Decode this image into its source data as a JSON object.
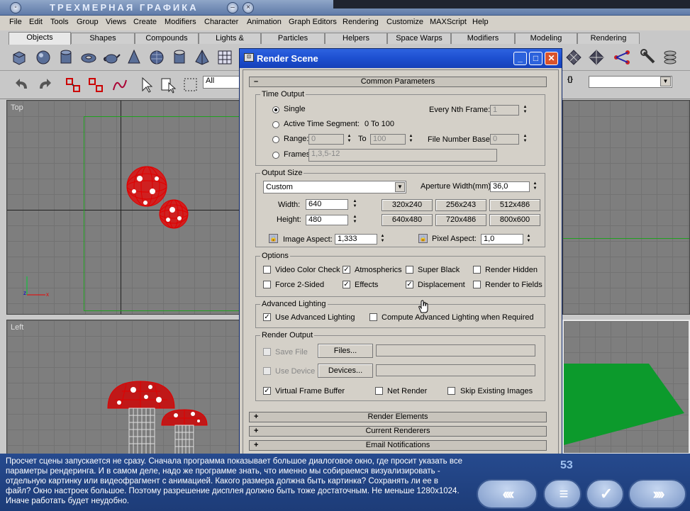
{
  "course_title": "ТРЕХМЕРНАЯ ГРАФИКА",
  "menu": [
    "File",
    "Edit",
    "Tools",
    "Group",
    "Views",
    "Create",
    "Modifiers",
    "Character",
    "Animation",
    "Graph Editors",
    "Rendering",
    "Customize",
    "MAXScript",
    "Help"
  ],
  "tabs": [
    "Objects",
    "Shapes",
    "Compounds",
    "Lights & Cameras",
    "Particles",
    "Helpers",
    "Space Warps",
    "Modifiers",
    "Modeling",
    "Rendering"
  ],
  "toolbar": {
    "selection_filter": "All"
  },
  "viewports": {
    "top_label": "Top",
    "left_label": "Left"
  },
  "dialog": {
    "title": "Render Scene",
    "common_params": "Common Parameters",
    "time_output": {
      "title": "Time Output",
      "single": "Single",
      "every_nth_frame": "Every Nth Frame:",
      "every_nth_value": "1",
      "active_time_segment": "Active Time Segment:",
      "active_time_value": "0 To 100",
      "range": "Range:",
      "range_from": "0",
      "range_to_label": "To",
      "range_to": "100",
      "file_number_base": "File Number Base:",
      "file_number_value": "0",
      "frames": "Frames",
      "frames_value": "1,3,5-12"
    },
    "output_size": {
      "title": "Output Size",
      "preset": "Custom",
      "aperture_label": "Aperture Width(mm):",
      "aperture_value": "36,0",
      "width_label": "Width:",
      "width_value": "640",
      "height_label": "Height:",
      "height_value": "480",
      "presets": [
        "320x240",
        "256x243",
        "512x486",
        "640x480",
        "720x486",
        "800x600"
      ],
      "image_aspect_label": "Image Aspect:",
      "image_aspect_value": "1,333",
      "pixel_aspect_label": "Pixel Aspect:",
      "pixel_aspect_value": "1,0"
    },
    "options": {
      "title": "Options",
      "video_color_check": "Video Color Check",
      "atmospherics": "Atmospherics",
      "super_black": "Super Black",
      "render_hidden": "Render Hidden",
      "force_2_sided": "Force 2-Sided",
      "effects": "Effects",
      "displacement": "Displacement",
      "render_to_fields": "Render to Fields"
    },
    "advanced_lighting": {
      "title": "Advanced Lighting",
      "use": "Use Advanced Lighting",
      "compute": "Compute Advanced Lighting when Required"
    },
    "render_output": {
      "title": "Render Output",
      "save_file": "Save File",
      "files_btn": "Files...",
      "use_device": "Use Device",
      "devices_btn": "Devices...",
      "virtual_frame_buffer": "Virtual Frame Buffer",
      "net_render": "Net Render",
      "skip_existing": "Skip Existing Images"
    },
    "rollups": [
      "Render Elements",
      "Current Renderers",
      "Email Notifications"
    ]
  },
  "caption": "Просчет сцены запускается не сразу. Сначала программа показывает большое диалоговое окно, где просит указать все параметры рендеринга. И в самом деле, надо же программе знать, что именно мы собираемся визуализировать - отдельную картинку или видеофрагмент с анимацией. Какого размера должна быть картинка? Сохранять ли ее в файл? Окно настроек большое. Поэтому разрешение дисплея должно быть тоже достаточным. Не меньше 1280x1024. Иначе работать будет неудобно.",
  "page_number": "53",
  "colors": {
    "title_blue": "#1d4fd0",
    "bottom_blue": "#264a8e",
    "wire_red": "#e00000",
    "ground_green": "#0c9a2c"
  }
}
